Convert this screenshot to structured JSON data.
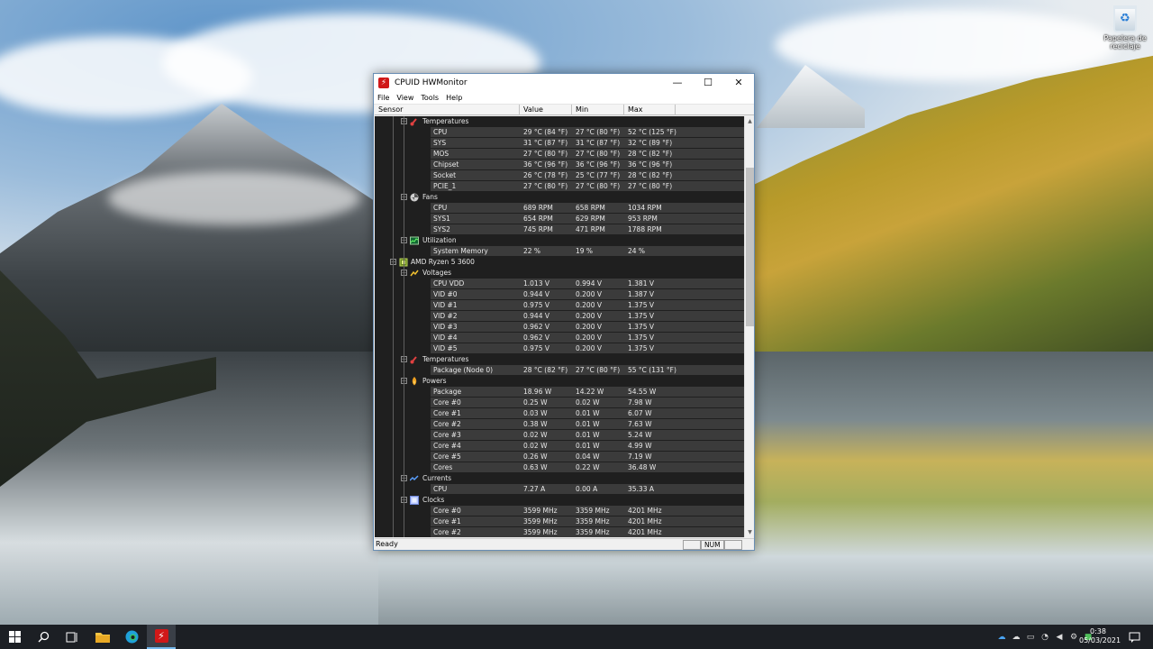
{
  "desktop": {
    "recycle_bin_label": "Papelera de reciclaje"
  },
  "window": {
    "title": "CPUID HWMonitor",
    "controls": {
      "minimize": "—",
      "maximize": "☐",
      "close": "✕"
    },
    "menu": [
      "File",
      "View",
      "Tools",
      "Help"
    ],
    "columns": [
      "Sensor",
      "Value",
      "Min",
      "Max"
    ],
    "rows": [
      {
        "type": "group",
        "level": 2,
        "icon": "thermometer-icon",
        "name": "Temperatures"
      },
      {
        "type": "data",
        "name": "CPU",
        "value": "29 °C  (84 °F)",
        "min": "27 °C  (80 °F)",
        "max": "52 °C  (125 °F)"
      },
      {
        "type": "data",
        "name": "SYS",
        "value": "31 °C  (87 °F)",
        "min": "31 °C  (87 °F)",
        "max": "32 °C  (89 °F)"
      },
      {
        "type": "data",
        "name": "MOS",
        "value": "27 °C  (80 °F)",
        "min": "27 °C  (80 °F)",
        "max": "28 °C  (82 °F)"
      },
      {
        "type": "data",
        "name": "Chipset",
        "value": "36 °C  (96 °F)",
        "min": "36 °C  (96 °F)",
        "max": "36 °C  (96 °F)"
      },
      {
        "type": "data",
        "name": "Socket",
        "value": "26 °C  (78 °F)",
        "min": "25 °C  (77 °F)",
        "max": "28 °C  (82 °F)"
      },
      {
        "type": "data",
        "name": "PCIE_1",
        "value": "27 °C  (80 °F)",
        "min": "27 °C  (80 °F)",
        "max": "27 °C  (80 °F)"
      },
      {
        "type": "group",
        "level": 2,
        "icon": "fan-icon",
        "name": "Fans"
      },
      {
        "type": "data",
        "name": "CPU",
        "value": "689 RPM",
        "min": "658 RPM",
        "max": "1034 RPM"
      },
      {
        "type": "data",
        "name": "SYS1",
        "value": "654 RPM",
        "min": "629 RPM",
        "max": "953 RPM"
      },
      {
        "type": "data",
        "name": "SYS2",
        "value": "745 RPM",
        "min": "471 RPM",
        "max": "1788 RPM"
      },
      {
        "type": "group",
        "level": 2,
        "icon": "utilization-icon",
        "name": "Utilization"
      },
      {
        "type": "data",
        "name": "System Memory",
        "value": "22 %",
        "min": "19 %",
        "max": "24 %"
      },
      {
        "type": "group",
        "level": 1,
        "icon": "processor-icon",
        "name": "AMD Ryzen 5 3600"
      },
      {
        "type": "group",
        "level": 2,
        "icon": "voltage-icon",
        "name": "Voltages"
      },
      {
        "type": "data",
        "name": "CPU VDD",
        "value": "1.013 V",
        "min": "0.994 V",
        "max": "1.381 V"
      },
      {
        "type": "data",
        "name": "VID #0",
        "value": "0.944 V",
        "min": "0.200 V",
        "max": "1.387 V"
      },
      {
        "type": "data",
        "name": "VID #1",
        "value": "0.975 V",
        "min": "0.200 V",
        "max": "1.375 V"
      },
      {
        "type": "data",
        "name": "VID #2",
        "value": "0.944 V",
        "min": "0.200 V",
        "max": "1.375 V"
      },
      {
        "type": "data",
        "name": "VID #3",
        "value": "0.962 V",
        "min": "0.200 V",
        "max": "1.375 V"
      },
      {
        "type": "data",
        "name": "VID #4",
        "value": "0.962 V",
        "min": "0.200 V",
        "max": "1.375 V"
      },
      {
        "type": "data",
        "name": "VID #5",
        "value": "0.975 V",
        "min": "0.200 V",
        "max": "1.375 V"
      },
      {
        "type": "group",
        "level": 2,
        "icon": "thermometer-icon",
        "name": "Temperatures"
      },
      {
        "type": "data",
        "name": "Package (Node 0)",
        "value": "28 °C  (82 °F)",
        "min": "27 °C  (80 °F)",
        "max": "55 °C  (131 °F)"
      },
      {
        "type": "group",
        "level": 2,
        "icon": "power-icon",
        "name": "Powers"
      },
      {
        "type": "data",
        "name": "Package",
        "value": "18.96 W",
        "min": "14.22 W",
        "max": "54.55 W"
      },
      {
        "type": "data",
        "name": "Core #0",
        "value": "0.25 W",
        "min": "0.02 W",
        "max": "7.98 W"
      },
      {
        "type": "data",
        "name": "Core #1",
        "value": "0.03 W",
        "min": "0.01 W",
        "max": "6.07 W"
      },
      {
        "type": "data",
        "name": "Core #2",
        "value": "0.38 W",
        "min": "0.01 W",
        "max": "7.63 W"
      },
      {
        "type": "data",
        "name": "Core #3",
        "value": "0.02 W",
        "min": "0.01 W",
        "max": "5.24 W"
      },
      {
        "type": "data",
        "name": "Core #4",
        "value": "0.02 W",
        "min": "0.01 W",
        "max": "4.99 W"
      },
      {
        "type": "data",
        "name": "Core #5",
        "value": "0.26 W",
        "min": "0.04 W",
        "max": "7.19 W"
      },
      {
        "type": "data",
        "name": "Cores",
        "value": "0.63 W",
        "min": "0.22 W",
        "max": "36.48 W"
      },
      {
        "type": "group",
        "level": 2,
        "icon": "current-icon",
        "name": "Currents"
      },
      {
        "type": "data",
        "name": "CPU",
        "value": "7.27 A",
        "min": "0.00 A",
        "max": "35.33 A"
      },
      {
        "type": "group",
        "level": 2,
        "icon": "clock-icon",
        "name": "Clocks"
      },
      {
        "type": "data",
        "name": "Core #0",
        "value": "3599 MHz",
        "min": "3359 MHz",
        "max": "4201 MHz"
      },
      {
        "type": "data",
        "name": "Core #1",
        "value": "3599 MHz",
        "min": "3359 MHz",
        "max": "4201 MHz"
      },
      {
        "type": "data",
        "name": "Core #2",
        "value": "3599 MHz",
        "min": "3359 MHz",
        "max": "4201 MHz"
      }
    ],
    "status": {
      "text": "Ready",
      "num": "NUM"
    }
  },
  "taskbar": {
    "start_icon": "windows-icon",
    "items": [
      "search-icon",
      "task-view-icon",
      "file-explorer-icon",
      "edge-icon",
      "hwmonitor-icon"
    ],
    "tray_icons": [
      "onedrive-icon",
      "cloud-icon",
      "network-icon",
      "wifi-icon",
      "volume-icon",
      "settings-icon",
      "security-icon",
      "chat-icon"
    ],
    "time": "0:38",
    "date": "05/03/2021"
  },
  "colors": {
    "tree_bg": "#1f1f1f",
    "row_bg": "#3b3b3b",
    "app_red": "#d01818",
    "taskbar_bg": "#1c1f24"
  }
}
